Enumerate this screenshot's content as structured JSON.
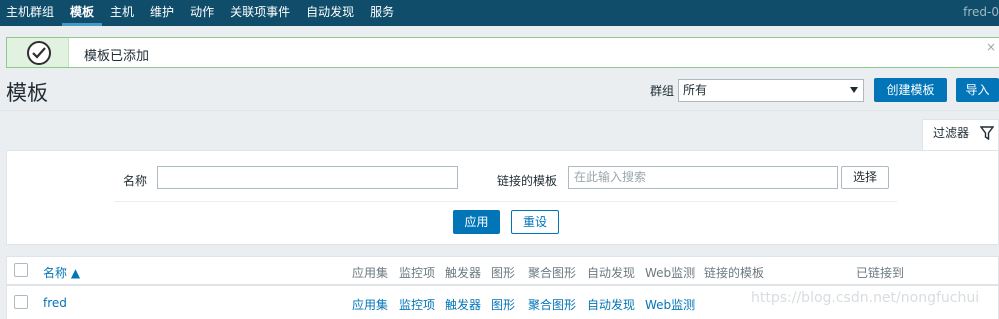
{
  "nav": {
    "items": [
      "主机群组",
      "模板",
      "主机",
      "维护",
      "动作",
      "关联项事件",
      "自动发现",
      "服务"
    ],
    "user": "fred-0"
  },
  "message": {
    "text": "模板已添加",
    "close": "×"
  },
  "page": {
    "title": "模板"
  },
  "header_controls": {
    "group_label": "群组",
    "group_value": "所有",
    "create_label": "创建模板",
    "import_label": "导入"
  },
  "filter": {
    "tab_label": "过滤器",
    "name_label": "名称",
    "name_value": "",
    "linked_label": "链接的模板",
    "linked_placeholder": "在此输入搜索",
    "select_label": "选择",
    "apply_label": "应用",
    "reset_label": "重设"
  },
  "table": {
    "headers": {
      "name": "名称 ▲",
      "apps": "应用集",
      "items": "监控项",
      "triggers": "触发器",
      "graphs": "图形",
      "screens": "聚合图形",
      "discovery": "自动发现",
      "web": "Web监测",
      "linked": "链接的模板",
      "linked_to": "已链接到"
    },
    "rows": [
      {
        "name": "fred",
        "apps": "应用集",
        "items": "监控项",
        "triggers": "触发器",
        "graphs": "图形",
        "screens": "聚合图形",
        "discovery": "自动发现",
        "web": "Web监测"
      }
    ]
  },
  "watermark": "https://blog.csdn.net/nongfuchui"
}
